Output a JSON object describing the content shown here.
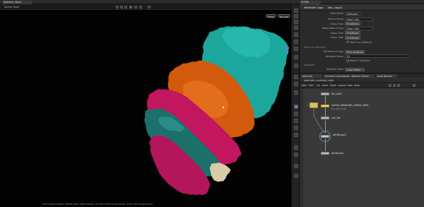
{
  "window": {
    "tabs": [
      "Network_Stack"
    ],
    "scene_tab": "SCENE"
  },
  "viewport": {
    "title": "Scene View",
    "camera_pill": "Persp",
    "display_pill": "No cam",
    "status_text": "Left mouse tumbles. Middle pans. Right dollies. Ctrl+Alt+Left mouse zooms. Shift+Left mouse brush."
  },
  "params": {
    "node_type": "Attribute Copy",
    "node_name": "attr_copy1",
    "rows": [
      {
        "label": "Feed Name",
        "kind": "input",
        "value": "attribcopy"
      },
      {
        "label": "Source Group",
        "kind": "input",
        "value": "head_cloth"
      },
      {
        "label": "Group Type",
        "kind": "drop",
        "value": "Primitives"
      },
      {
        "label": "Destination Group",
        "kind": "input",
        "value": "head_cloth"
      },
      {
        "label": "Group Type",
        "kind": "drop",
        "value": "Primitives"
      },
      {
        "label": "Group Type",
        "kind": "drop",
        "value": "Primitives"
      },
      {
        "label": "",
        "kind": "check",
        "value": "Match by Attribute",
        "checked": true
      },
      {
        "label": "Attribute to Copy",
        "kind": "drop",
        "value": "Pixel Attribute"
      },
      {
        "label": "Attribute Name",
        "kind": "input",
        "value": "Cd"
      },
      {
        "label": "",
        "kind": "check",
        "value": "Match P Attribute",
        "checked": true
      },
      {
        "label": "Attribute Class",
        "kind": "drop",
        "value": "Auto-Detect"
      },
      {
        "label": "",
        "kind": "check",
        "value": "Copy Local Variable",
        "checked": true
      }
    ],
    "section_match": "Match by Attribute",
    "section_attr": "Attributes",
    "section_alloc": "Allocation"
  },
  "network": {
    "tabs": [
      "/obj/cloth",
      "Geometry Spreadsheet",
      "Material Palette",
      "Asset Browser"
    ],
    "path": "/obj/cloth_sim/head_cloth",
    "menu": [
      "Add",
      "Edit",
      "Go",
      "View",
      "Tools",
      "Layout",
      "Labs",
      "Help"
    ],
    "nodes": [
      {
        "label": "file_cloth",
        "sub": ""
      },
      {
        "label": "vellum_headcloth_collider_0001",
        "sub": "Geo Primitives"
      },
      {
        "label": "sim_file",
        "sub": ""
      },
      {
        "label": "attribcopy1",
        "sub": ""
      },
      {
        "label": "attribcolor",
        "sub": ""
      }
    ]
  },
  "colors": {
    "teal": "#20a39a",
    "orange": "#d05a12",
    "magenta": "#c0185e",
    "dark_teal": "#1f6d6a",
    "selected_node": "#f0d26a"
  }
}
